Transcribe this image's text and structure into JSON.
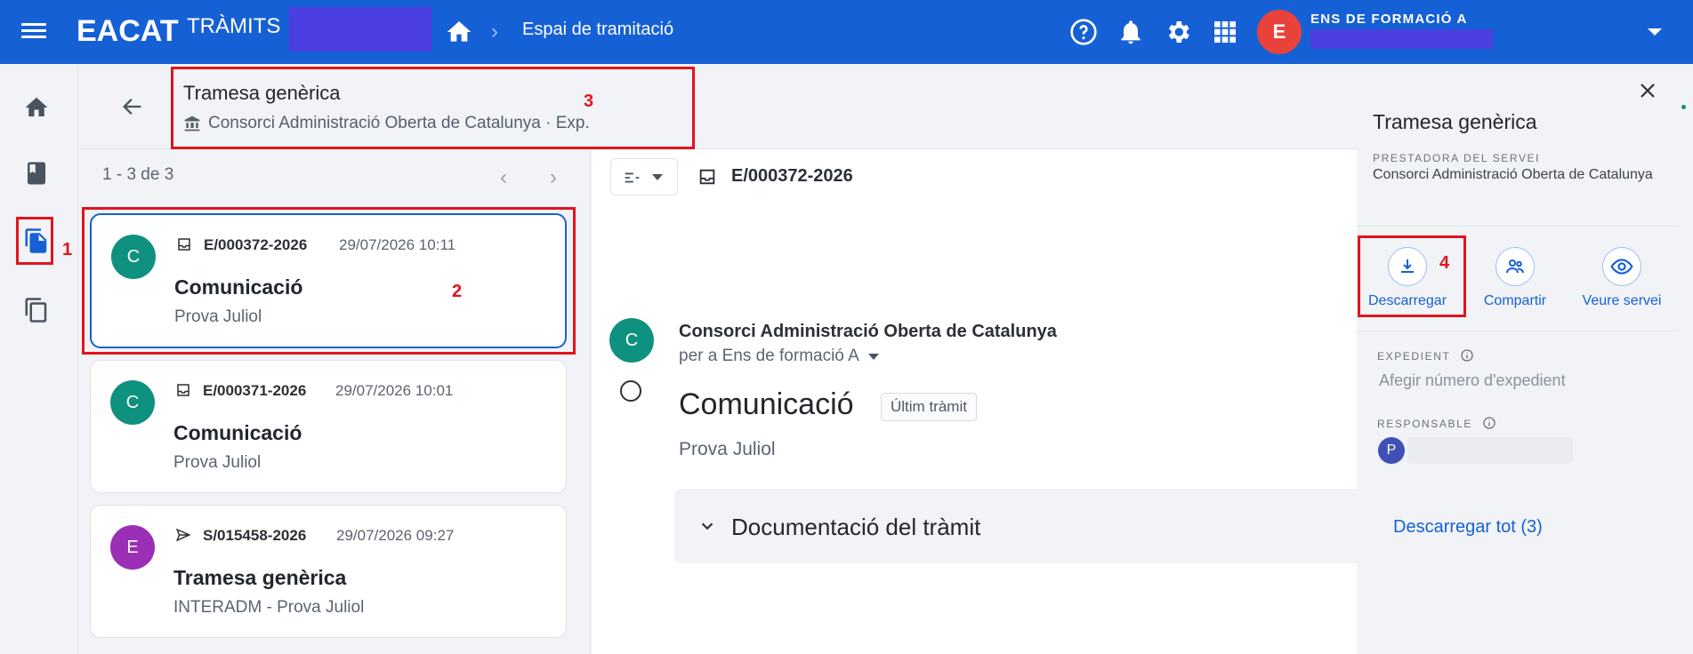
{
  "topbar": {
    "logo": "EACAT",
    "logo_sub": "TRÀMITS",
    "breadcrumb": "Espai de tramitació",
    "org_name": "ENS DE FORMACIÓ A",
    "avatar_initial": "E"
  },
  "header": {
    "title": "Tramesa genèrica",
    "subtitle": "Consorci Administració Oberta de Catalunya · Exp."
  },
  "list": {
    "pager": "1 - 3 de 3",
    "items": [
      {
        "initial": "C",
        "color": "#0f917f",
        "ref": "E/000372-2026",
        "date": "29/07/2026 10:11",
        "title": "Comunicació",
        "subtitle": "Prova Juliol",
        "type_icon": "inbox-icon"
      },
      {
        "initial": "C",
        "color": "#0f917f",
        "ref": "E/000371-2026",
        "date": "29/07/2026 10:01",
        "title": "Comunicació",
        "subtitle": "Prova Juliol",
        "type_icon": "inbox-icon"
      },
      {
        "initial": "E",
        "color": "#9b2fb5",
        "ref": "S/015458-2026",
        "date": "29/07/2026 09:27",
        "title": "Tramesa genèrica",
        "subtitle": "INTERADM - Prova Juliol",
        "type_icon": "send-icon"
      }
    ]
  },
  "detail": {
    "ref": "E/000372-2026",
    "avatar_initial": "C",
    "from": "Consorci Administració Oberta de Catalunya",
    "to": "per a Ens de formació A",
    "title": "Comunicació",
    "badge": "Últim tràmit",
    "description": "Prova Juliol",
    "docs_title": "Documentació del tràmit",
    "docs_link": "Descarregar tot (3)"
  },
  "info": {
    "title": "Tramesa genèrica",
    "provider_label": "PRESTADORA DEL SERVEI",
    "provider_value": "Consorci Administració Oberta de Catalunya",
    "actions": {
      "download": "Descarregar",
      "share": "Compartir",
      "view": "Veure servei"
    },
    "expedient_label": "EXPEDIENT",
    "expedient_placeholder": "Afegir número d'expedient",
    "responsable_label": "RESPONSABLE",
    "responsable_initial": "P"
  },
  "annotations": {
    "a1": "1",
    "a2": "2",
    "a3": "3",
    "a4": "4"
  },
  "colors": {
    "brand": "#1660d6",
    "annotation": "#e4131e"
  }
}
